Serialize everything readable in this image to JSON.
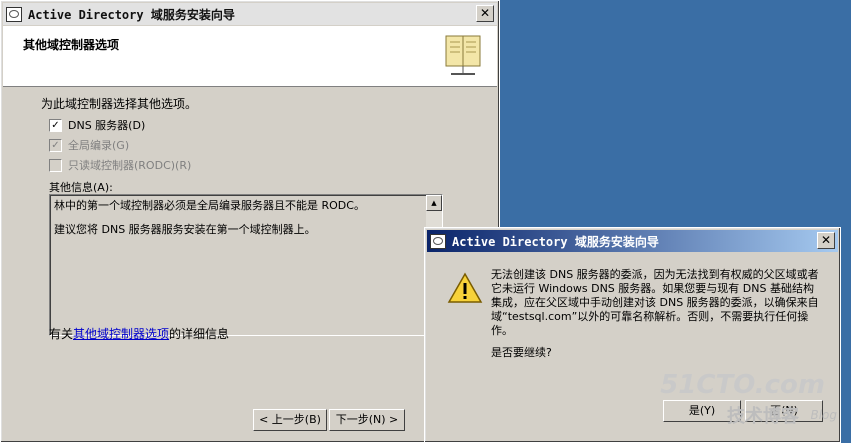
{
  "wizard": {
    "title": "Active Directory 域服务安装向导",
    "close_glyph": "✕",
    "header_title": "其他域控制器选项",
    "prompt": "为此域控制器选择其他选项。",
    "options": [
      {
        "label": "DNS 服务器(D)",
        "checked": true,
        "enabled": true
      },
      {
        "label": "全局编录(G)",
        "checked": true,
        "enabled": false
      },
      {
        "label": "只读域控制器(RODC)(R)",
        "checked": false,
        "enabled": false
      }
    ],
    "info_label": "其他信息(A):",
    "info_lines": [
      "林中的第一个域控制器必须是全局编录服务器且不能是 RODC。",
      "建议您将 DNS 服务器服务安装在第一个域控制器上。"
    ],
    "detail_prefix": "有关",
    "detail_link": "其他域控制器选项",
    "detail_suffix": "的详细信息",
    "back_button": "< 上一步(B)",
    "next_button": "下一步(N) >"
  },
  "dialog": {
    "title": "Active Directory 域服务安装向导",
    "close_glyph": "✕",
    "message": "无法创建该 DNS 服务器的委派，因为无法找到有权威的父区域或者它未运行 Windows DNS 服务器。如果您要与现有 DNS 基础结构集成，应在父区域中手动创建对该 DNS 服务器的委派，以确保来自域“testsql.com”以外的可靠名称解析。否则，不需要执行任何操作。",
    "question": "是否要继续?",
    "yes_button": "是(Y)",
    "no_button": "否(N)"
  },
  "watermark": {
    "site": "51CTO.com",
    "cn": "技术博客",
    "blog": "Blog"
  }
}
